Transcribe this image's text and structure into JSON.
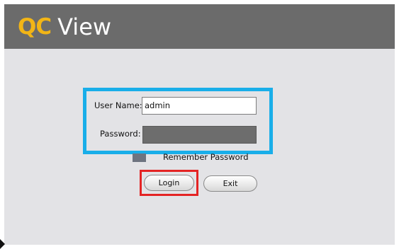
{
  "app": {
    "logo_mark": "QC",
    "logo_word": "View"
  },
  "form": {
    "username_label": "User Name:",
    "username_value": "admin",
    "password_label": "Password:",
    "password_value": "",
    "remember_label": "Remember Password",
    "remember_checked": false
  },
  "buttons": {
    "login_label": "Login",
    "exit_label": "Exit"
  },
  "colors": {
    "header_bg": "#6b6b6b",
    "logo_accent": "#f2b516",
    "credentials_highlight": "#19aee9",
    "login_highlight": "#e42424"
  }
}
